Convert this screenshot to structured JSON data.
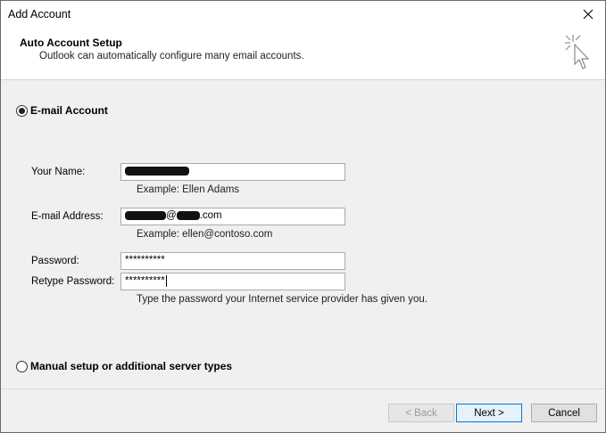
{
  "window": {
    "title": "Add Account",
    "close_glyph": "✕"
  },
  "header": {
    "title": "Auto Account Setup",
    "subtitle": "Outlook can automatically configure many email accounts.",
    "icon": "cursor-sparkle-icon"
  },
  "options": {
    "email_account_label": "E-mail Account",
    "email_account_selected": true,
    "manual_setup_label": "Manual setup or additional server types",
    "manual_setup_selected": false
  },
  "form": {
    "name_label": "Your Name:",
    "name_value_redacted": true,
    "name_example": "Example: Ellen Adams",
    "email_label": "E-mail Address:",
    "email_value_visible": "@",
    "email_value_suffix": ".com",
    "email_example": "Example: ellen@contoso.com",
    "password_label": "Password:",
    "password_value": "**********",
    "retype_label": "Retype Password:",
    "retype_value": "**********",
    "password_hint": "Type the password your Internet service provider has given you."
  },
  "buttons": {
    "back": "< Back",
    "next": "Next >",
    "cancel": "Cancel"
  }
}
